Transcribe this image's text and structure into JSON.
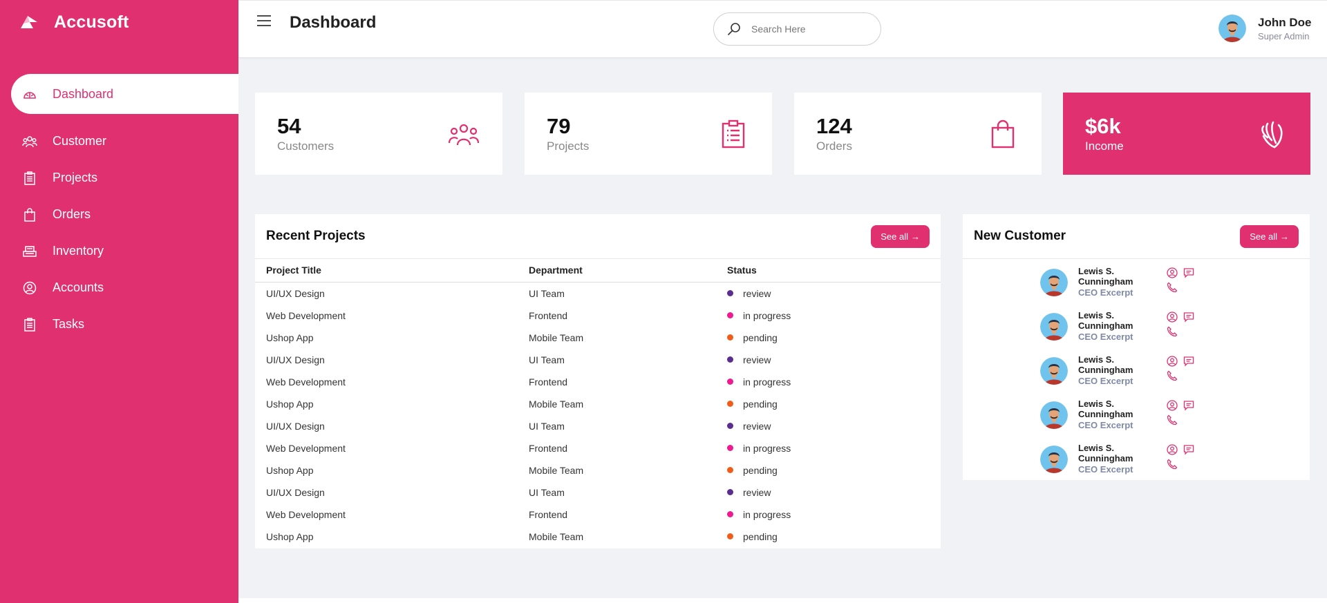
{
  "brand": {
    "name": "Accusoft"
  },
  "nav": [
    {
      "label": "Dashboard",
      "icon": "dashboard-icon",
      "active": true
    },
    {
      "label": "Customer",
      "icon": "users-icon"
    },
    {
      "label": "Projects",
      "icon": "clipboard-icon"
    },
    {
      "label": "Orders",
      "icon": "bag-icon"
    },
    {
      "label": "Inventory",
      "icon": "inventory-icon"
    },
    {
      "label": "Accounts",
      "icon": "account-icon"
    },
    {
      "label": "Tasks",
      "icon": "tasks-icon"
    }
  ],
  "header": {
    "title": "Dashboard",
    "search_placeholder": "Search Here",
    "user_name": "John Doe",
    "user_role": "Super Admin"
  },
  "cards": [
    {
      "value": "54",
      "label": "Customers",
      "icon": "users-icon"
    },
    {
      "value": "79",
      "label": "Projects",
      "icon": "clipboard-icon"
    },
    {
      "value": "124",
      "label": "Orders",
      "icon": "bag-icon"
    },
    {
      "value": "$6k",
      "label": "Income",
      "icon": "hand-icon"
    }
  ],
  "recent_projects": {
    "title": "Recent Projects",
    "see_all": "See all",
    "columns": [
      "Project Title",
      "Department",
      "Status"
    ],
    "rows": [
      {
        "title": "UI/UX Design",
        "department": "UI Team",
        "status": "review"
      },
      {
        "title": "Web Development",
        "department": "Frontend",
        "status": "in progress"
      },
      {
        "title": "Ushop App",
        "department": "Mobile Team",
        "status": "pending"
      },
      {
        "title": "UI/UX Design",
        "department": "UI Team",
        "status": "review"
      },
      {
        "title": "Web Development",
        "department": "Frontend",
        "status": "in progress"
      },
      {
        "title": "Ushop App",
        "department": "Mobile Team",
        "status": "pending"
      },
      {
        "title": "UI/UX Design",
        "department": "UI Team",
        "status": "review"
      },
      {
        "title": "Web Development",
        "department": "Frontend",
        "status": "in progress"
      },
      {
        "title": "Ushop App",
        "department": "Mobile Team",
        "status": "pending"
      },
      {
        "title": "UI/UX Design",
        "department": "UI Team",
        "status": "review"
      },
      {
        "title": "Web Development",
        "department": "Frontend",
        "status": "in progress"
      },
      {
        "title": "Ushop App",
        "department": "Mobile Team",
        "status": "pending"
      }
    ]
  },
  "status_colors": {
    "review": "#5b2d90",
    "in progress": "#ee1a8e",
    "pending": "#f25c1a"
  },
  "new_customer": {
    "title": "New Customer",
    "see_all": "See all",
    "items": [
      {
        "name_line1": "Lewis S.",
        "name_line2": "Cunningham",
        "role": "CEO Excerpt"
      },
      {
        "name_line1": "Lewis S.",
        "name_line2": "Cunningham",
        "role": "CEO Excerpt"
      },
      {
        "name_line1": "Lewis S.",
        "name_line2": "Cunningham",
        "role": "CEO Excerpt"
      },
      {
        "name_line1": "Lewis S.",
        "name_line2": "Cunningham",
        "role": "CEO Excerpt"
      },
      {
        "name_line1": "Lewis S.",
        "name_line2": "Cunningham",
        "role": "CEO Excerpt"
      }
    ]
  },
  "colors": {
    "accent": "#e0306f",
    "background": "#f0f2f6"
  }
}
